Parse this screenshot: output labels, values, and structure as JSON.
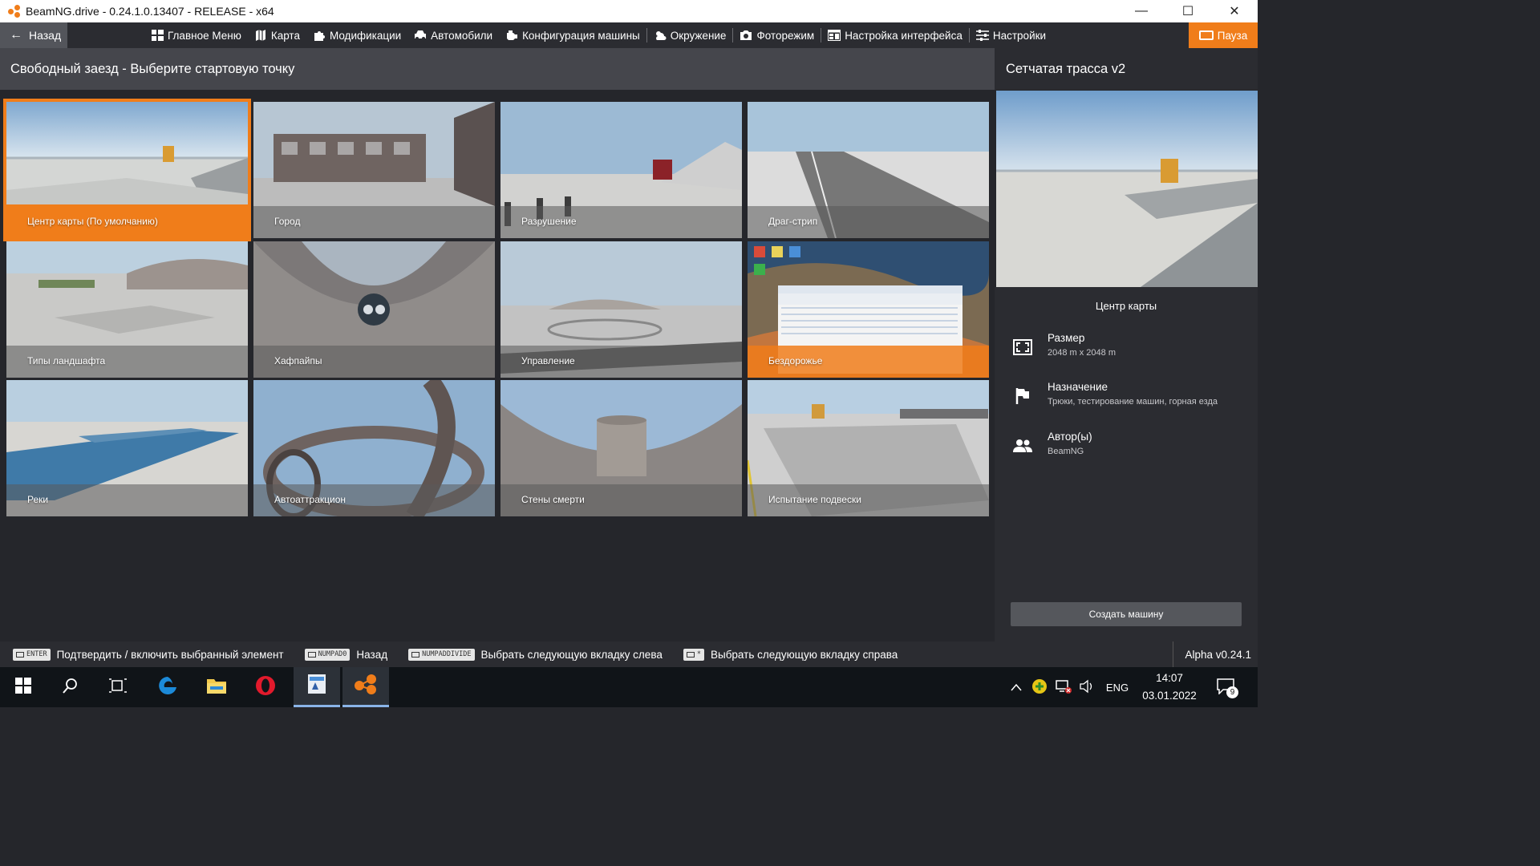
{
  "window": {
    "title": "BeamNG.drive - 0.24.1.0.13407 - RELEASE - x64",
    "minimize": "—",
    "maximize": "☐",
    "close": "✕"
  },
  "menu": {
    "back": "Назад",
    "items": [
      {
        "label": "Главное Меню",
        "icon": "home-grid-icon"
      },
      {
        "label": "Карта",
        "icon": "map-icon"
      },
      {
        "label": "Модификации",
        "icon": "puzzle-icon"
      },
      {
        "label": "Автомобили",
        "icon": "car-icon"
      },
      {
        "label": "Конфигурация машины",
        "icon": "engine-icon"
      },
      {
        "label": "Окружение",
        "icon": "weather-icon"
      },
      {
        "label": "Фоторежим",
        "icon": "camera-icon"
      },
      {
        "label": "Настройка интерфейса",
        "icon": "ui-layout-icon"
      },
      {
        "label": "Настройки",
        "icon": "sliders-icon"
      }
    ],
    "pause": "Пауза"
  },
  "main": {
    "header": "Свободный заезд - Выберите стартовую точку",
    "tiles": [
      {
        "label": "Центр карты (По умолчанию)",
        "state": "selected"
      },
      {
        "label": "Город",
        "state": ""
      },
      {
        "label": "Разрушение",
        "state": ""
      },
      {
        "label": "Драг-стрип",
        "state": ""
      },
      {
        "label": "Типы ландшафта",
        "state": ""
      },
      {
        "label": "Хафпайпы",
        "state": ""
      },
      {
        "label": "Управление",
        "state": ""
      },
      {
        "label": "Бездорожье",
        "state": "highlighted"
      },
      {
        "label": "Реки",
        "state": ""
      },
      {
        "label": "Автоаттракцион",
        "state": ""
      },
      {
        "label": "Стены смерти",
        "state": ""
      },
      {
        "label": "Испытание подвески",
        "state": ""
      }
    ]
  },
  "side": {
    "title": "Сетчатая трасса v2",
    "spawn_name": "Центр карты",
    "size_label": "Размер",
    "size_value": "2048 m x 2048 m",
    "purpose_label": "Назначение",
    "purpose_value": "Трюки, тестирование машин, горная езда",
    "authors_label": "Автор(ы)",
    "authors_value": "BeamNG",
    "create_button": "Создать машину"
  },
  "hints": [
    {
      "key": "ENTER",
      "text": "Подтвердить / включить выбранный элемент"
    },
    {
      "key": "NUMPAD0",
      "text": "Назад"
    },
    {
      "key": "NUMPADDIVIDE",
      "text": "Выбрать следующую вкладку слева"
    },
    {
      "key": "*",
      "text": "Выбрать следующую вкладку справа"
    }
  ],
  "version": "Alpha v0.24.1",
  "taskbar": {
    "lang": "ENG",
    "time": "14:07",
    "date": "03.01.2022",
    "notifications": "9"
  },
  "colors": {
    "accent": "#f07d1a",
    "panel": "#2b2c31",
    "header": "#45464c"
  }
}
